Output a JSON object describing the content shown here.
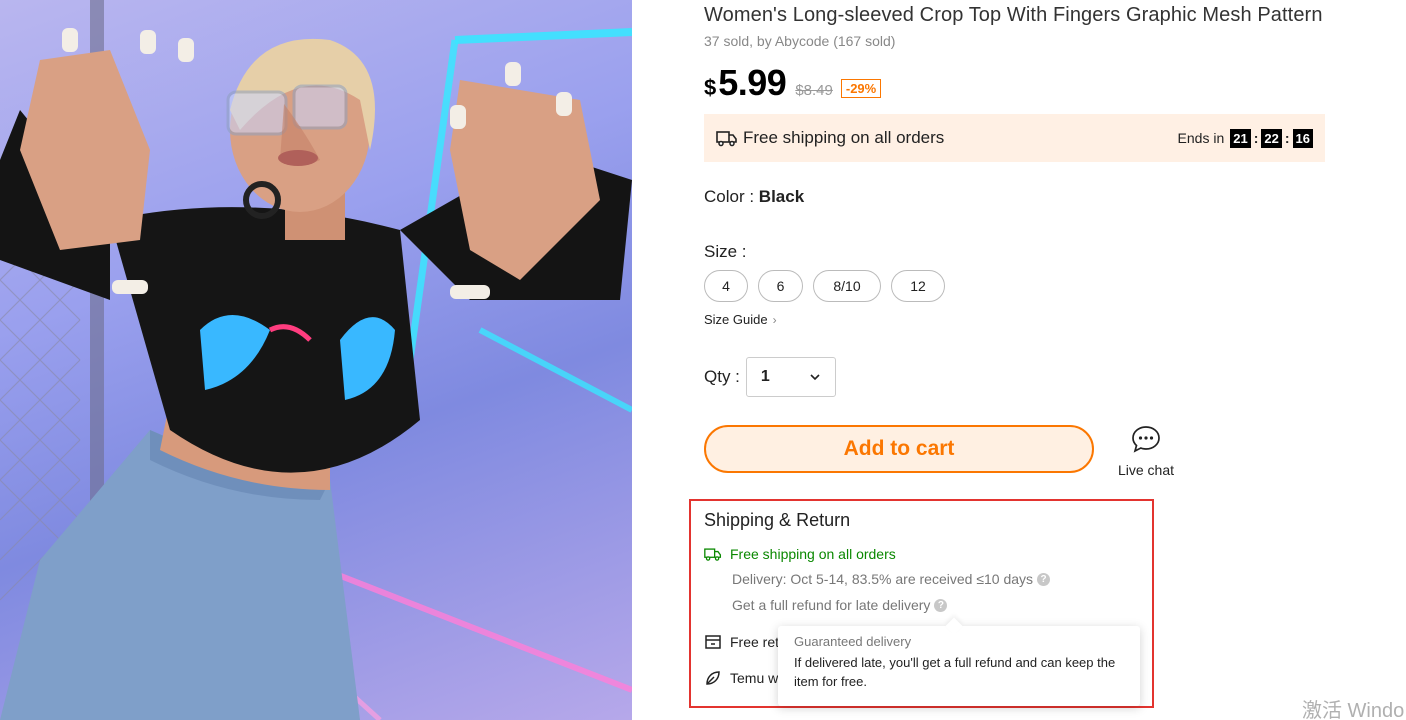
{
  "product": {
    "title": "Women's Long-sleeved Crop Top With Fingers Graphic Mesh Pattern",
    "sold_info": "37 sold, by Abycode (167 sold)",
    "currency": "$",
    "price": "5.99",
    "original_price": "$8.49",
    "discount": "-29%"
  },
  "banner": {
    "icon": "truck-icon",
    "text": "Free shipping on all orders",
    "ends_label": "Ends in",
    "hours": "21",
    "minutes": "22",
    "seconds": "16"
  },
  "color": {
    "label": "Color : ",
    "value": "Black"
  },
  "size": {
    "label": "Size :",
    "options": [
      "4",
      "6",
      "8/10",
      "12"
    ],
    "guide": "Size Guide"
  },
  "qty": {
    "label": "Qty :",
    "value": "1"
  },
  "actions": {
    "add_to_cart": "Add to cart",
    "live_chat": "Live chat"
  },
  "shipping": {
    "title": "Shipping & Return",
    "free_shipping": "Free shipping on all orders",
    "delivery": "Delivery: Oct 5-14, 83.5% are received ≤10 days",
    "refund": "Get a full refund for late delivery",
    "free_returns_partial": "Free ret",
    "temu_partial": "Temu w"
  },
  "tooltip": {
    "title": "Guaranteed delivery",
    "body": "If delivered late, you'll get a full refund and can keep the item for free."
  },
  "watermark": "激活 Windo",
  "colors": {
    "accent": "#fb7701",
    "green": "#0a8800",
    "highlight_border": "#e3342f"
  }
}
